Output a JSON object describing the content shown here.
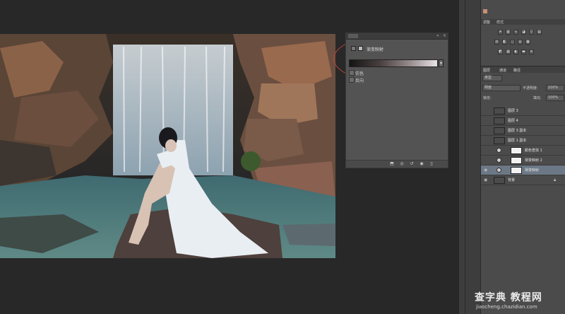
{
  "colors": {
    "workspace": "#282828",
    "panel": "#535353",
    "dock": "#4b4b4b",
    "annotation": "#c3463a",
    "selected_layer": "#6c7886"
  },
  "properties_panel": {
    "tab_label": "属性",
    "collapse_glyph": "«",
    "close_glyph": "×",
    "title": "渐变映射",
    "dropdown_glyph": "▾",
    "options": [
      {
        "label": "仿色",
        "checked": false
      },
      {
        "label": "反向",
        "checked": false
      }
    ]
  },
  "adjustments_panel": {
    "tabs": [
      "调整",
      "样式"
    ],
    "icons": [
      "brightness-icon",
      "levels-icon",
      "curves-icon",
      "exposure-icon",
      "vibrance-icon",
      "hue-icon",
      "color-balance-icon",
      "bw-icon",
      "photo-filter-icon",
      "channel-mixer-icon",
      "color-lookup-icon",
      "invert-icon",
      "posterize-icon",
      "threshold-icon",
      "gradient-map-icon",
      "selective-color-icon"
    ]
  },
  "layers_panel": {
    "tabs": [
      "图层",
      "通道",
      "路径"
    ],
    "kind_filter": "类型",
    "blend_mode": "明度",
    "opacity_label": "不透明度:",
    "opacity_value": "100%",
    "lock_label": "锁定:",
    "fill_label": "填充:",
    "fill_value": "100%",
    "layers": [
      {
        "name": "图层 3",
        "thumb": "photo",
        "visible": false,
        "selected": false,
        "adjust": false
      },
      {
        "name": "图层 4",
        "thumb": "photo",
        "visible": false,
        "selected": false,
        "adjust": false
      },
      {
        "name": "图层 3 副本",
        "thumb": "photo",
        "visible": false,
        "selected": false,
        "adjust": false
      },
      {
        "name": "图层 1 副本",
        "thumb": "photo",
        "visible": false,
        "selected": false,
        "adjust": false
      },
      {
        "name": "颜色查找 1",
        "thumb": "white",
        "visible": false,
        "selected": false,
        "adjust": true
      },
      {
        "name": "渐变映射 2",
        "thumb": "white",
        "visible": false,
        "selected": false,
        "adjust": true
      },
      {
        "name": "渐变映射",
        "thumb": "white",
        "visible": true,
        "selected": true,
        "adjust": true
      },
      {
        "name": "背景",
        "thumb": "photo",
        "visible": true,
        "selected": false,
        "adjust": false
      }
    ]
  },
  "watermark": {
    "big": "查字典 教程网",
    "small": "jiaocheng.chazidian.com"
  }
}
